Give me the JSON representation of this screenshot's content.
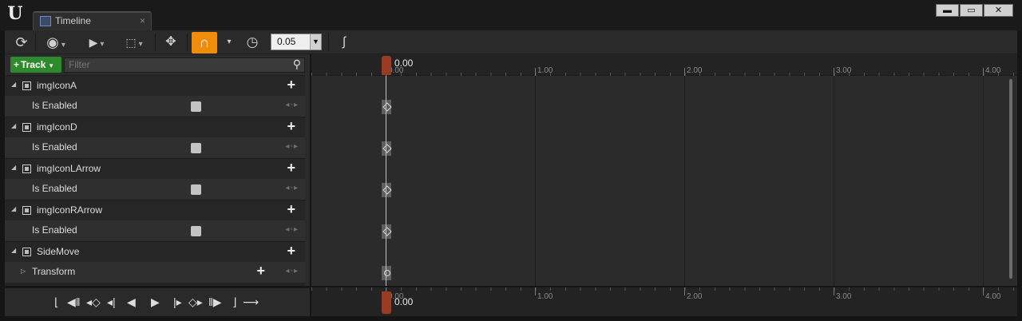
{
  "window": {
    "tab_title": "Timeline",
    "tab_close": "×",
    "minimize": "▬",
    "maximize": "▭",
    "close": "✕"
  },
  "toolbar": {
    "icons": [
      "refresh-icon",
      "eye-icon",
      "play-icon",
      "select-icon",
      "move-icon",
      "magnet-icon",
      "clock-icon",
      "curve-icon"
    ],
    "snap_value": "0.05",
    "snap_enabled": true,
    "accent_color": "#f08b0c"
  },
  "tracks_panel": {
    "add_track_label": "Track",
    "filter_placeholder": "Filter"
  },
  "tracks": [
    {
      "object": "imgIconA",
      "property": "Is Enabled",
      "kind": "bool"
    },
    {
      "object": "imgIconD",
      "property": "Is Enabled",
      "kind": "bool"
    },
    {
      "object": "imgIconLArrow",
      "property": "Is Enabled",
      "kind": "bool"
    },
    {
      "object": "imgIconRArrow",
      "property": "Is Enabled",
      "kind": "bool"
    },
    {
      "object": "SideMove",
      "property": "Transform",
      "kind": "transform"
    }
  ],
  "timeline": {
    "playhead_time": "0.00",
    "ticks": [
      "0.00",
      "1.00",
      "2.00",
      "3.00",
      "4.00"
    ],
    "playhead_color": "#9b3b22"
  },
  "transport": {
    "icons": [
      "set-start-icon",
      "jump-start-icon",
      "prev-key-icon",
      "step-back-icon",
      "play-reverse-icon",
      "play-icon",
      "step-forward-icon",
      "next-key-icon",
      "jump-end-icon",
      "set-end-icon",
      "loop-icon"
    ]
  }
}
